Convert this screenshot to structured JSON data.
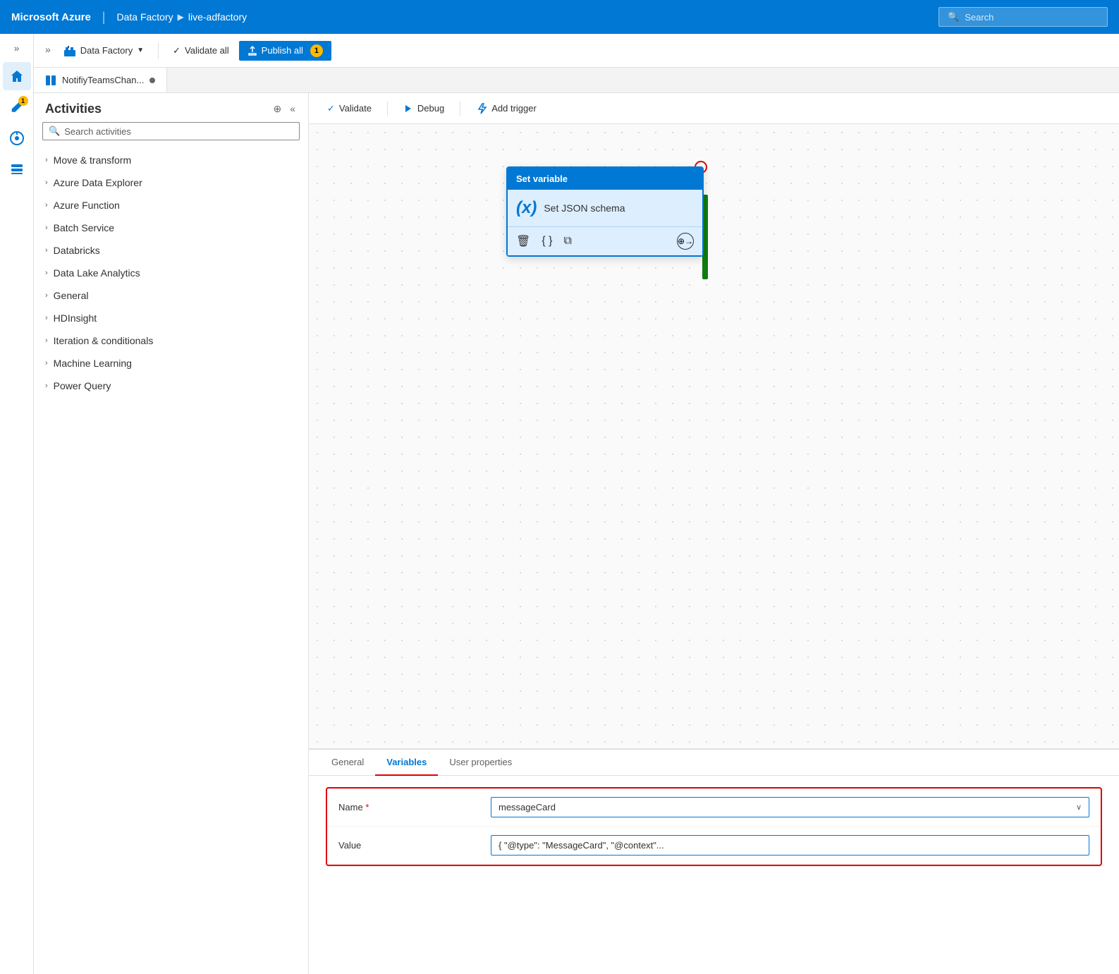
{
  "topNav": {
    "brand": "Microsoft Azure",
    "separator": "|",
    "breadcrumb1": "Data Factory",
    "breadcrumbArrow": "▶",
    "breadcrumb2": "live-adfactory",
    "searchPlaceholder": "Search"
  },
  "toolbar": {
    "expandLabel": "»",
    "dataFactoryLabel": "Data Factory",
    "validateAllLabel": "Validate all",
    "publishAllLabel": "Publish all",
    "publishBadge": "1"
  },
  "tabStrip": {
    "tabLabel": "NotifiyTeamsChan..."
  },
  "canvasToolbar": {
    "validateLabel": "Validate",
    "debugLabel": "Debug",
    "addTriggerLabel": "Add trigger"
  },
  "activities": {
    "title": "Activities",
    "searchPlaceholder": "Search activities",
    "groups": [
      {
        "label": "Move & transform"
      },
      {
        "label": "Azure Data Explorer"
      },
      {
        "label": "Azure Function"
      },
      {
        "label": "Batch Service"
      },
      {
        "label": "Databricks"
      },
      {
        "label": "Data Lake Analytics"
      },
      {
        "label": "General"
      },
      {
        "label": "HDInsight"
      },
      {
        "label": "Iteration & conditionals"
      },
      {
        "label": "Machine Learning"
      },
      {
        "label": "Power Query"
      }
    ]
  },
  "activityCard": {
    "headerLabel": "Set variable",
    "iconSymbol": "(x)",
    "titleLabel": "Set JSON schema"
  },
  "bottomTabs": {
    "general": "General",
    "variables": "Variables",
    "userProperties": "User properties"
  },
  "form": {
    "nameLabel": "Name",
    "nameRequired": "*",
    "nameValue": "messageCard",
    "valueLabel": "Value",
    "valueValue": "{ \"@type\": \"MessageCard\", \"@context\"..."
  },
  "colors": {
    "blue": "#0078d4",
    "red": "#e00000",
    "green": "#107c10",
    "yellow": "#ffb900"
  }
}
